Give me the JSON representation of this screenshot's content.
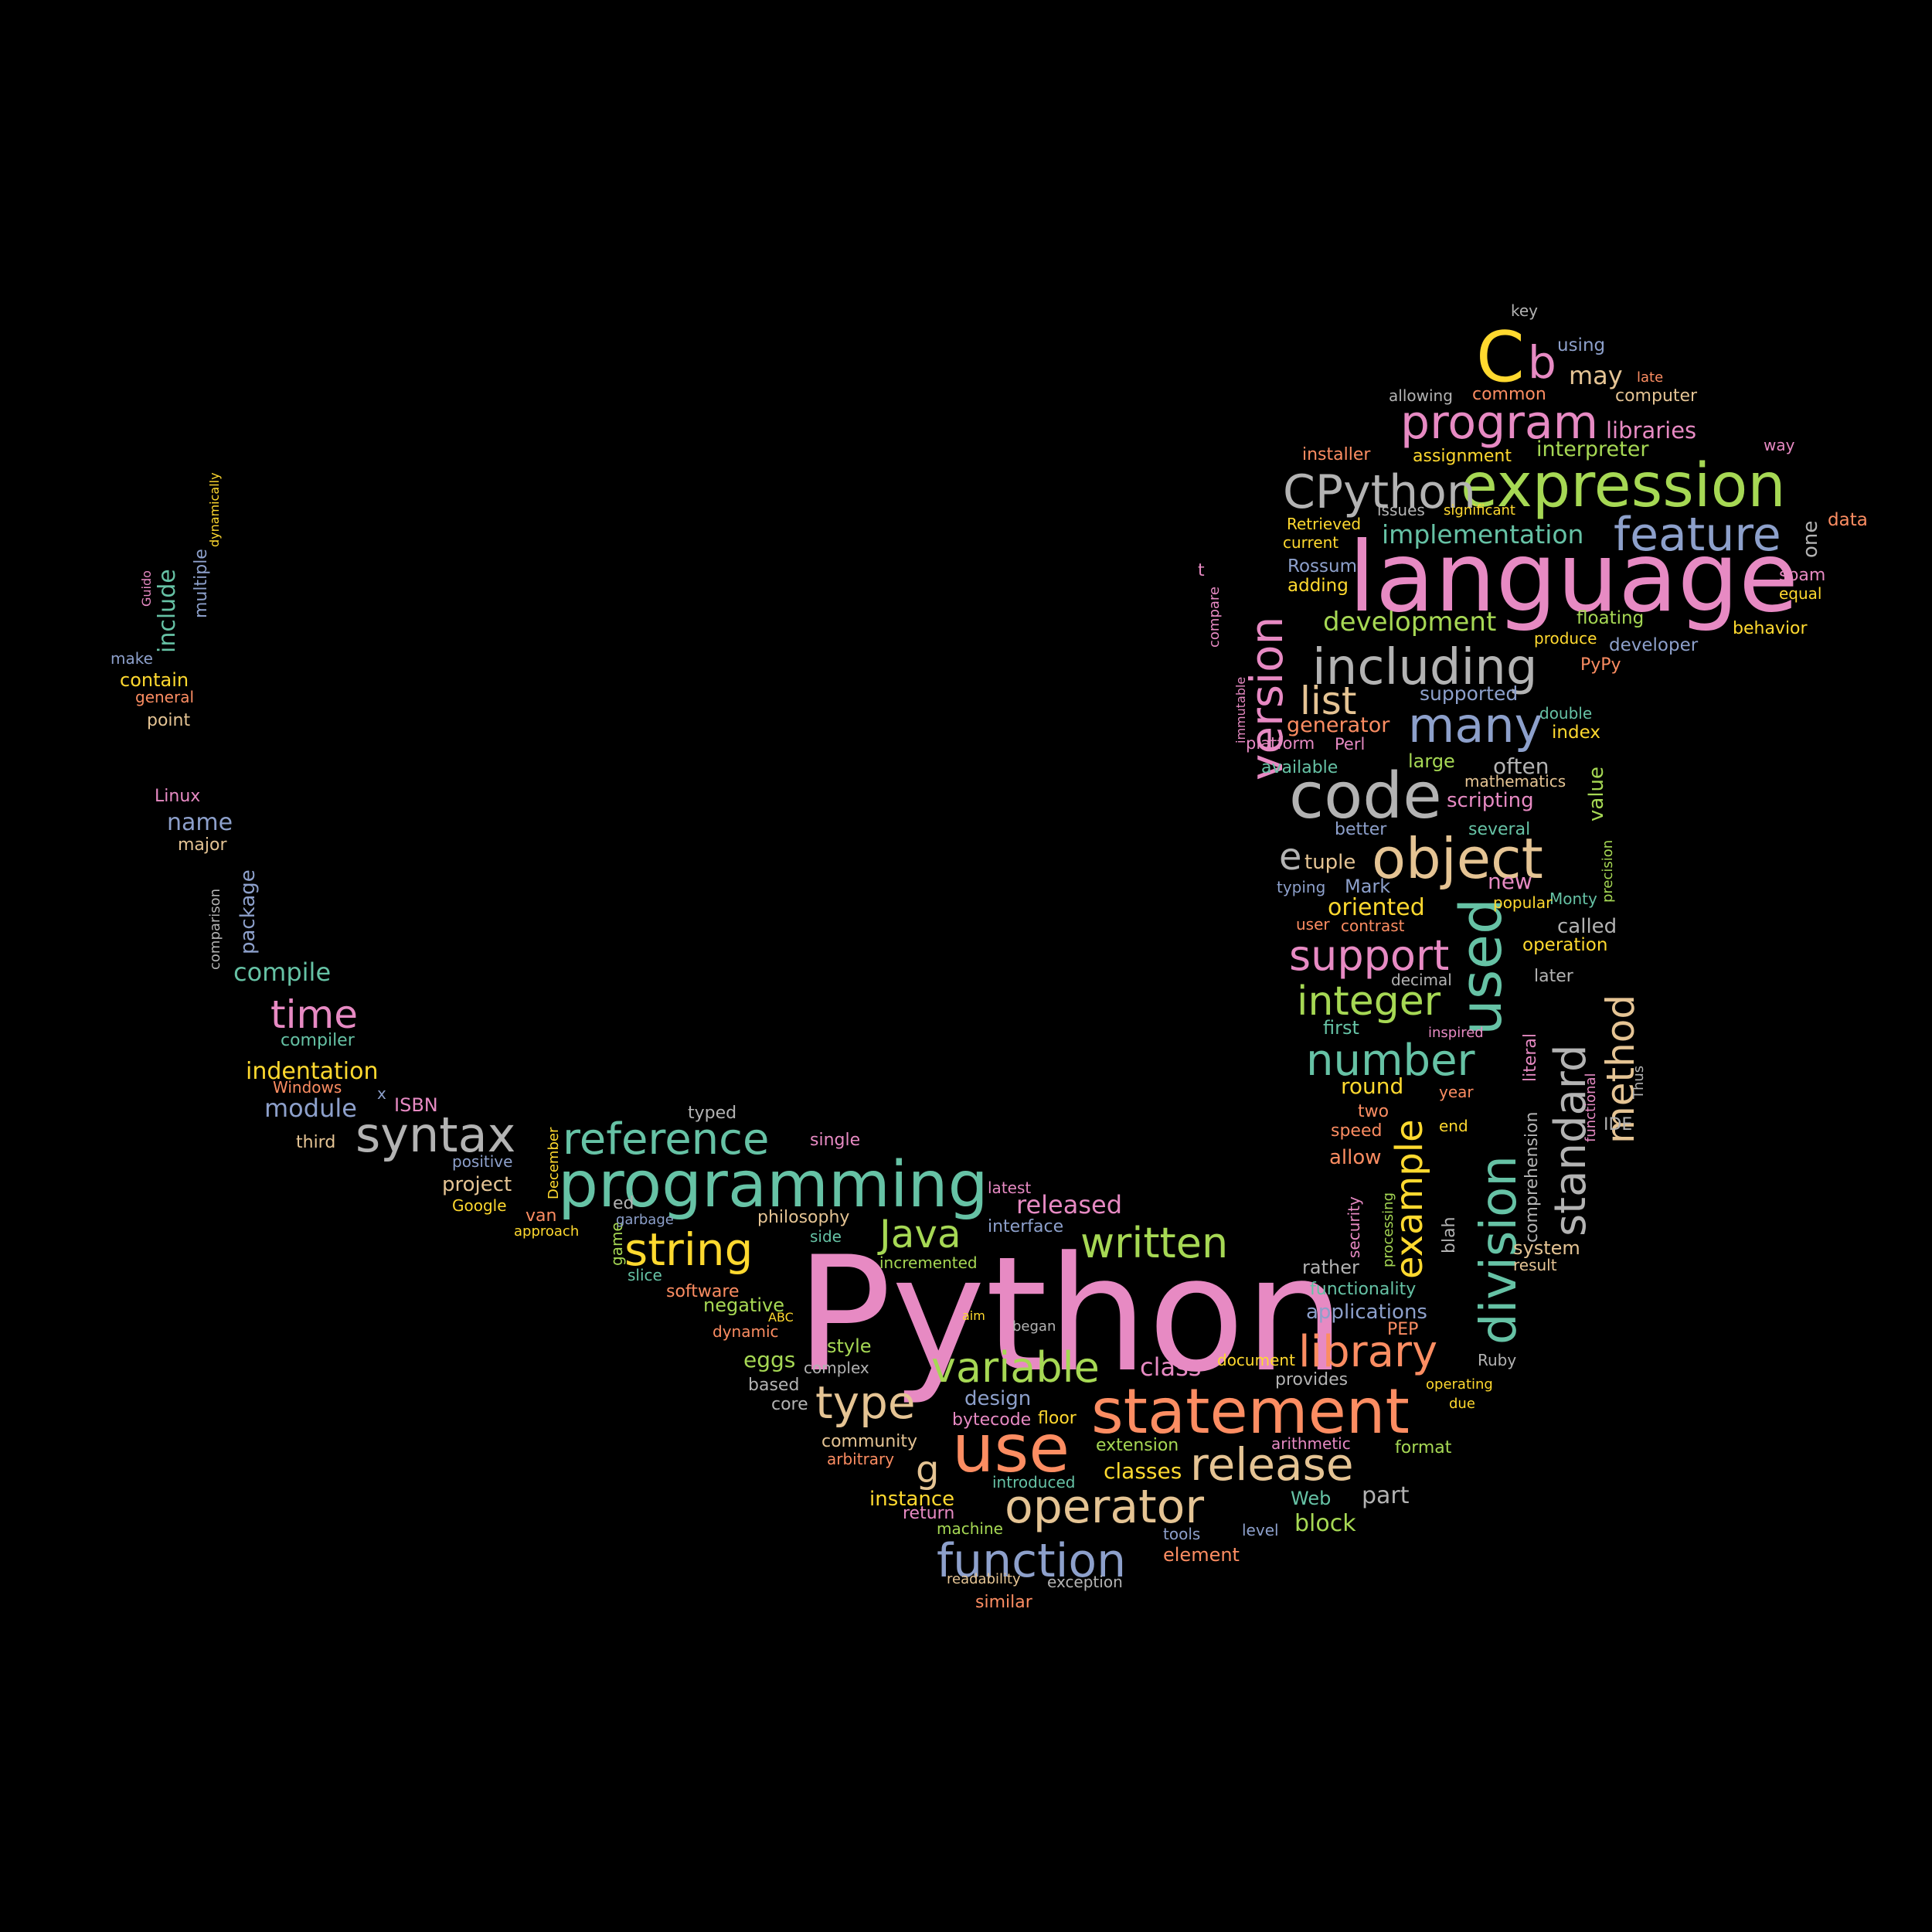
{
  "colors": {
    "pink": "#e78ac3",
    "green": "#a6d854",
    "teal": "#66c2a5",
    "blue": "#8da0cb",
    "orange": "#fc8d62",
    "yellow": "#ffd92f",
    "tan": "#e5c494",
    "gray": "#b3b3b3"
  },
  "words": [
    {
      "text": "Python",
      "color": "pink"
    },
    {
      "text": "language",
      "color": "pink"
    },
    {
      "text": "expression",
      "color": "green"
    },
    {
      "text": "CPython",
      "color": "gray"
    },
    {
      "text": "C",
      "color": "yellow"
    },
    {
      "text": "b",
      "color": "pink"
    },
    {
      "text": "program",
      "color": "pink"
    },
    {
      "text": "feature",
      "color": "blue"
    },
    {
      "text": "including",
      "color": "gray"
    },
    {
      "text": "version",
      "color": "pink"
    },
    {
      "text": "code",
      "color": "gray"
    },
    {
      "text": "object",
      "color": "tan"
    },
    {
      "text": "many",
      "color": "blue"
    },
    {
      "text": "list",
      "color": "tan"
    },
    {
      "text": "used",
      "color": "teal"
    },
    {
      "text": "division",
      "color": "teal"
    },
    {
      "text": "standard",
      "color": "gray"
    },
    {
      "text": "method",
      "color": "tan"
    },
    {
      "text": "example",
      "color": "yellow"
    },
    {
      "text": "support",
      "color": "pink"
    },
    {
      "text": "integer",
      "color": "green"
    },
    {
      "text": "number",
      "color": "teal"
    },
    {
      "text": "programming",
      "color": "teal"
    },
    {
      "text": "reference",
      "color": "teal"
    },
    {
      "text": "syntax",
      "color": "gray"
    },
    {
      "text": "string",
      "color": "yellow"
    },
    {
      "text": "Java",
      "color": "green"
    },
    {
      "text": "written",
      "color": "green"
    },
    {
      "text": "statement",
      "color": "orange"
    },
    {
      "text": "library",
      "color": "orange"
    },
    {
      "text": "variable",
      "color": "green"
    },
    {
      "text": "type",
      "color": "tan"
    },
    {
      "text": "use",
      "color": "orange"
    },
    {
      "text": "release",
      "color": "tan"
    },
    {
      "text": "operator",
      "color": "tan"
    },
    {
      "text": "function",
      "color": "blue"
    },
    {
      "text": "time",
      "color": "pink"
    },
    {
      "text": "e",
      "color": "gray"
    },
    {
      "text": "g",
      "color": "tan"
    },
    {
      "text": "implementation",
      "color": "teal"
    },
    {
      "text": "development",
      "color": "green"
    },
    {
      "text": "interpreter",
      "color": "green"
    },
    {
      "text": "libraries",
      "color": "pink"
    },
    {
      "text": "may",
      "color": "tan"
    },
    {
      "text": "using",
      "color": "blue"
    },
    {
      "text": "key",
      "color": "gray"
    },
    {
      "text": "computer",
      "color": "tan"
    },
    {
      "text": "late",
      "color": "orange"
    },
    {
      "text": "allowing",
      "color": "gray"
    },
    {
      "text": "common",
      "color": "orange"
    },
    {
      "text": "installer",
      "color": "orange"
    },
    {
      "text": "assignment",
      "color": "yellow"
    },
    {
      "text": "way",
      "color": "pink"
    },
    {
      "text": "issues",
      "color": "gray"
    },
    {
      "text": "significant",
      "color": "yellow"
    },
    {
      "text": "Retrieved",
      "color": "yellow"
    },
    {
      "text": "current",
      "color": "yellow"
    },
    {
      "text": "Rossum",
      "color": "blue"
    },
    {
      "text": "adding",
      "color": "yellow"
    },
    {
      "text": "one",
      "color": "gray"
    },
    {
      "text": "data",
      "color": "orange"
    },
    {
      "text": "spam",
      "color": "pink"
    },
    {
      "text": "equal",
      "color": "yellow"
    },
    {
      "text": "floating",
      "color": "green"
    },
    {
      "text": "behavior",
      "color": "yellow"
    },
    {
      "text": "produce",
      "color": "yellow"
    },
    {
      "text": "developer",
      "color": "blue"
    },
    {
      "text": "PyPy",
      "color": "orange"
    },
    {
      "text": "supported",
      "color": "blue"
    },
    {
      "text": "generator",
      "color": "orange"
    },
    {
      "text": "double",
      "color": "teal"
    },
    {
      "text": "index",
      "color": "yellow"
    },
    {
      "text": "platform",
      "color": "pink"
    },
    {
      "text": "Perl",
      "color": "pink"
    },
    {
      "text": "large",
      "color": "green"
    },
    {
      "text": "value",
      "color": "green"
    },
    {
      "text": "available",
      "color": "teal"
    },
    {
      "text": "often",
      "color": "gray"
    },
    {
      "text": "mathematics",
      "color": "tan"
    },
    {
      "text": "scripting",
      "color": "pink"
    },
    {
      "text": "better",
      "color": "blue"
    },
    {
      "text": "several",
      "color": "teal"
    },
    {
      "text": "tuple",
      "color": "tan"
    },
    {
      "text": "precision",
      "color": "green"
    },
    {
      "text": "typing",
      "color": "blue"
    },
    {
      "text": "Mark",
      "color": "blue"
    },
    {
      "text": "new",
      "color": "pink"
    },
    {
      "text": "Monty",
      "color": "teal"
    },
    {
      "text": "popular",
      "color": "yellow"
    },
    {
      "text": "oriented",
      "color": "yellow"
    },
    {
      "text": "user",
      "color": "orange"
    },
    {
      "text": "contrast",
      "color": "orange"
    },
    {
      "text": "called",
      "color": "gray"
    },
    {
      "text": "operation",
      "color": "yellow"
    },
    {
      "text": "decimal",
      "color": "gray"
    },
    {
      "text": "later",
      "color": "gray"
    },
    {
      "text": "first",
      "color": "teal"
    },
    {
      "text": "inspired",
      "color": "pink"
    },
    {
      "text": "literal",
      "color": "pink"
    },
    {
      "text": "functional",
      "color": "pink"
    },
    {
      "text": "Thus",
      "color": "gray"
    },
    {
      "text": "round",
      "color": "yellow"
    },
    {
      "text": "year",
      "color": "orange"
    },
    {
      "text": "IDE",
      "color": "gray"
    },
    {
      "text": "two",
      "color": "orange"
    },
    {
      "text": "end",
      "color": "yellow"
    },
    {
      "text": "speed",
      "color": "orange"
    },
    {
      "text": "comprehension",
      "color": "gray"
    },
    {
      "text": "allow",
      "color": "orange"
    },
    {
      "text": "security",
      "color": "pink"
    },
    {
      "text": "processing",
      "color": "green"
    },
    {
      "text": "blah",
      "color": "gray"
    },
    {
      "text": "system",
      "color": "tan"
    },
    {
      "text": "result",
      "color": "tan"
    },
    {
      "text": "rather",
      "color": "gray"
    },
    {
      "text": "functionality",
      "color": "teal"
    },
    {
      "text": "applications",
      "color": "blue"
    },
    {
      "text": "PEP",
      "color": "orange"
    },
    {
      "text": "Ruby",
      "color": "gray"
    },
    {
      "text": "document",
      "color": "yellow"
    },
    {
      "text": "provides",
      "color": "gray"
    },
    {
      "text": "operating",
      "color": "yellow"
    },
    {
      "text": "due",
      "color": "yellow"
    },
    {
      "text": "class",
      "color": "pink"
    },
    {
      "text": "design",
      "color": "blue"
    },
    {
      "text": "floor",
      "color": "yellow"
    },
    {
      "text": "bytecode",
      "color": "pink"
    },
    {
      "text": "extension",
      "color": "green"
    },
    {
      "text": "arithmetic",
      "color": "pink"
    },
    {
      "text": "format",
      "color": "green"
    },
    {
      "text": "classes",
      "color": "yellow"
    },
    {
      "text": "introduced",
      "color": "teal"
    },
    {
      "text": "Web",
      "color": "teal"
    },
    {
      "text": "part",
      "color": "gray"
    },
    {
      "text": "block",
      "color": "green"
    },
    {
      "text": "tools",
      "color": "blue"
    },
    {
      "text": "level",
      "color": "blue"
    },
    {
      "text": "element",
      "color": "orange"
    },
    {
      "text": "machine",
      "color": "green"
    },
    {
      "text": "exception",
      "color": "gray"
    },
    {
      "text": "readability",
      "color": "tan"
    },
    {
      "text": "similar",
      "color": "orange"
    },
    {
      "text": "return",
      "color": "pink"
    },
    {
      "text": "instance",
      "color": "yellow"
    },
    {
      "text": "arbitrary",
      "color": "orange"
    },
    {
      "text": "community",
      "color": "tan"
    },
    {
      "text": "core",
      "color": "gray"
    },
    {
      "text": "based",
      "color": "gray"
    },
    {
      "text": "complex",
      "color": "gray"
    },
    {
      "text": "eggs",
      "color": "green"
    },
    {
      "text": "style",
      "color": "green"
    },
    {
      "text": "dynamic",
      "color": "orange"
    },
    {
      "text": "ABC",
      "color": "yellow"
    },
    {
      "text": "aim",
      "color": "yellow"
    },
    {
      "text": "began",
      "color": "gray"
    },
    {
      "text": "negative",
      "color": "green"
    },
    {
      "text": "software",
      "color": "orange"
    },
    {
      "text": "slice",
      "color": "teal"
    },
    {
      "text": "incremented",
      "color": "green"
    },
    {
      "text": "interface",
      "color": "blue"
    },
    {
      "text": "side",
      "color": "teal"
    },
    {
      "text": "game",
      "color": "green"
    },
    {
      "text": "philosophy",
      "color": "tan"
    },
    {
      "text": "released",
      "color": "pink"
    },
    {
      "text": "latest",
      "color": "pink"
    },
    {
      "text": "garbage",
      "color": "blue"
    },
    {
      "text": "ed",
      "color": "gray"
    },
    {
      "text": "approach",
      "color": "yellow"
    },
    {
      "text": "van",
      "color": "orange"
    },
    {
      "text": "Google",
      "color": "yellow"
    },
    {
      "text": "project",
      "color": "tan"
    },
    {
      "text": "December",
      "color": "yellow"
    },
    {
      "text": "positive",
      "color": "blue"
    },
    {
      "text": "typed",
      "color": "gray"
    },
    {
      "text": "single",
      "color": "pink"
    },
    {
      "text": "third",
      "color": "tan"
    },
    {
      "text": "module",
      "color": "blue"
    },
    {
      "text": "ISBN",
      "color": "pink"
    },
    {
      "text": "x",
      "color": "blue"
    },
    {
      "text": "Windows",
      "color": "orange"
    },
    {
      "text": "indentation",
      "color": "yellow"
    },
    {
      "text": "compiler",
      "color": "teal"
    },
    {
      "text": "compile",
      "color": "teal"
    },
    {
      "text": "package",
      "color": "blue"
    },
    {
      "text": "comparison",
      "color": "gray"
    },
    {
      "text": "major",
      "color": "tan"
    },
    {
      "text": "name",
      "color": "blue"
    },
    {
      "text": "Linux",
      "color": "pink"
    },
    {
      "text": "point",
      "color": "tan"
    },
    {
      "text": "general",
      "color": "orange"
    },
    {
      "text": "contain",
      "color": "yellow"
    },
    {
      "text": "make",
      "color": "blue"
    },
    {
      "text": "include",
      "color": "teal"
    },
    {
      "text": "multiple",
      "color": "blue"
    },
    {
      "text": "Guido",
      "color": "pink"
    },
    {
      "text": "dynamically",
      "color": "yellow"
    },
    {
      "text": "t",
      "color": "pink"
    },
    {
      "text": "compare",
      "color": "pink"
    },
    {
      "text": "immutable",
      "color": "pink"
    }
  ]
}
